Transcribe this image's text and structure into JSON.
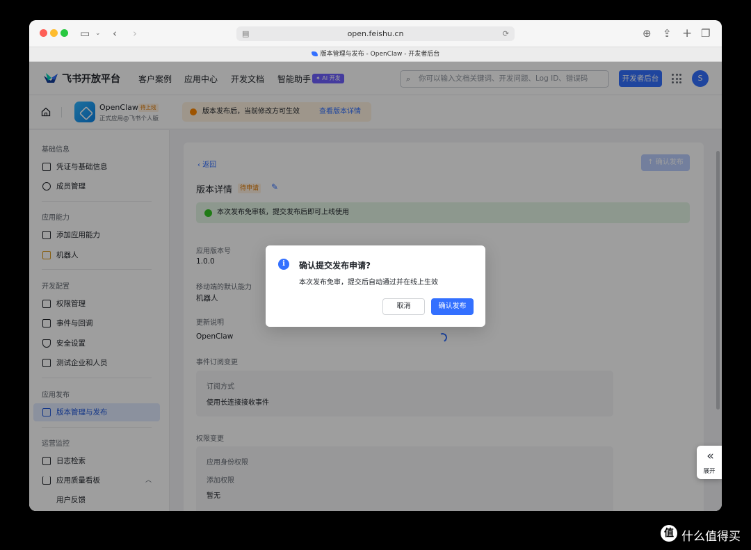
{
  "browser": {
    "url": "open.feishu.cn",
    "tab_title": "版本管理与发布 - OpenClaw - 开发者后台"
  },
  "header": {
    "brand": "飞书开放平台",
    "nav": [
      "客户案例",
      "应用中心",
      "开发文档",
      "智能助手"
    ],
    "ai_tag": "✦ AI 开发",
    "search_placeholder": "你可以输入文档关键词、开发问题、Log ID、错误码",
    "dev_button": "开发者后台",
    "avatar_initial": "S"
  },
  "app_bar": {
    "app_name": "OpenClaw",
    "app_status": "待上线",
    "app_sub": "正式应用@飞书个人版",
    "notice": "版本发布后，当前修改方可生效",
    "notice_link": "查看版本详情"
  },
  "sidebar": {
    "groups": [
      {
        "label": "基础信息",
        "items": [
          "凭证与基础信息",
          "成员管理"
        ]
      },
      {
        "label": "应用能力",
        "items": [
          "添加应用能力",
          "机器人"
        ]
      },
      {
        "label": "开发配置",
        "items": [
          "权限管理",
          "事件与回调",
          "安全设置",
          "测试企业和人员"
        ]
      },
      {
        "label": "应用发布",
        "items": [
          "版本管理与发布"
        ]
      },
      {
        "label": "运营监控",
        "items": [
          "日志检索",
          "应用质量看板"
        ]
      }
    ],
    "sub_item": "用户反馈",
    "active_item": "版本管理与发布"
  },
  "content": {
    "back": "返回",
    "confirm_top": "确认发布",
    "title": "版本详情",
    "badge": "待申请",
    "success_msg": "本次发布免审核，提交发布后即可上线使用",
    "fields": [
      {
        "label": "应用版本号",
        "value": "1.0.0"
      },
      {
        "label": "移动端的默认能力",
        "value": "机器人"
      },
      {
        "label": "更新说明",
        "value": "OpenClaw"
      }
    ],
    "event_section": "事件订阅变更",
    "event_box": {
      "label": "订阅方式",
      "value": "使用长连接接收事件"
    },
    "perm_section": "权限变更",
    "perm_box": {
      "label1": "应用身份权限",
      "label2": "添加权限",
      "value": "暂无"
    }
  },
  "dialog": {
    "title": "确认提交发布申请?",
    "body": "本次发布免审，提交后自动通过并在线上生效",
    "cancel": "取消",
    "confirm": "确认发布"
  },
  "expand": {
    "label": "展开"
  },
  "watermark": {
    "logo": "值",
    "text": "什么值得买"
  }
}
